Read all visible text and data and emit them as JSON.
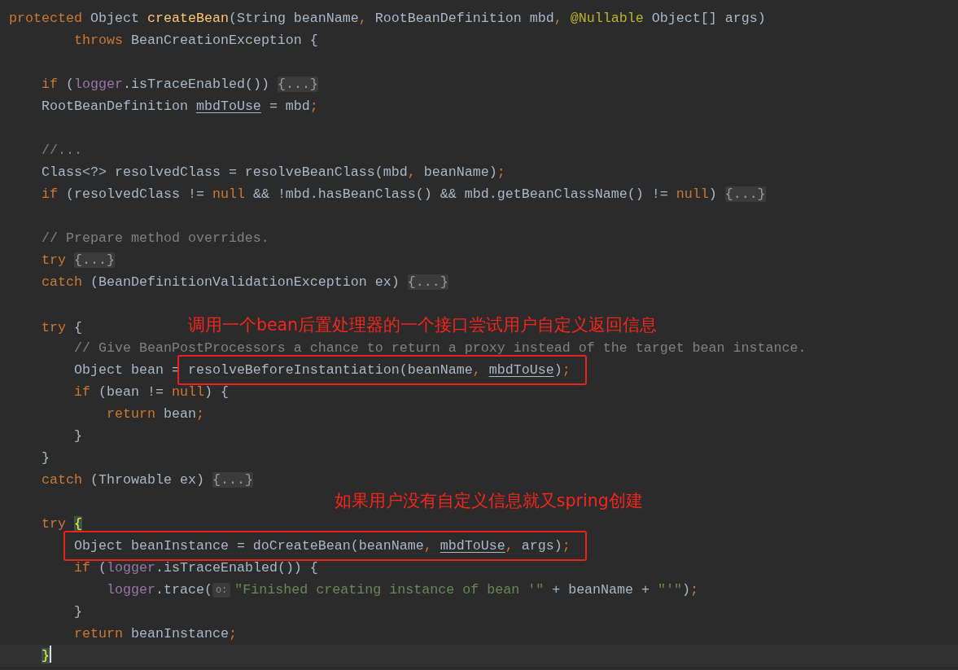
{
  "editor": {
    "lines": [
      {
        "current": false,
        "tokens": [
          {
            "kind": "kw",
            "text": "protected"
          },
          {
            "kind": "plain",
            "text": " Object "
          },
          {
            "kind": "method",
            "text": "createBean"
          },
          {
            "kind": "plain",
            "text": "(String beanName"
          },
          {
            "kind": "punct",
            "text": ","
          },
          {
            "kind": "plain",
            "text": " RootBeanDefinition mbd"
          },
          {
            "kind": "punct",
            "text": ","
          },
          {
            "kind": "annotation",
            "text": " @Nullable"
          },
          {
            "kind": "plain",
            "text": " Object[] args)"
          }
        ]
      },
      {
        "current": false,
        "tokens": [
          {
            "kind": "kw",
            "text": "        throws"
          },
          {
            "kind": "plain",
            "text": " BeanCreationException {"
          }
        ]
      },
      {
        "current": false
      },
      {
        "current": false,
        "tokens": [
          {
            "kind": "kw",
            "text": "    if"
          },
          {
            "kind": "plain",
            "text": " ("
          },
          {
            "kind": "field",
            "text": "logger"
          },
          {
            "kind": "plain",
            "text": ".isTraceEnabled()) "
          },
          {
            "kind": "fold",
            "text": "{...}"
          }
        ]
      },
      {
        "current": false,
        "tokens": [
          {
            "kind": "plain",
            "text": "    RootBeanDefinition "
          },
          {
            "kind": "var",
            "text": "mbdToUse"
          },
          {
            "kind": "plain",
            "text": " = mbd"
          },
          {
            "kind": "punct",
            "text": ";"
          }
        ]
      },
      {
        "current": false
      },
      {
        "current": false,
        "tokens": [
          {
            "kind": "comment",
            "text": "    //..."
          }
        ]
      },
      {
        "current": false,
        "tokens": [
          {
            "kind": "plain",
            "text": "    Class<?> resolvedClass = resolveBeanClass(mbd"
          },
          {
            "kind": "punct",
            "text": ","
          },
          {
            "kind": "plain",
            "text": " beanName)"
          },
          {
            "kind": "punct",
            "text": ";"
          }
        ]
      },
      {
        "current": false,
        "tokens": [
          {
            "kind": "kw",
            "text": "    if"
          },
          {
            "kind": "plain",
            "text": " (resolvedClass != "
          },
          {
            "kind": "kw",
            "text": "null"
          },
          {
            "kind": "plain",
            "text": " && !mbd.hasBeanClass() && mbd.getBeanClassName() != "
          },
          {
            "kind": "kw",
            "text": "null"
          },
          {
            "kind": "plain",
            "text": ") "
          },
          {
            "kind": "fold",
            "text": "{...}"
          }
        ]
      },
      {
        "current": false
      },
      {
        "current": false,
        "tokens": [
          {
            "kind": "comment",
            "text": "    // Prepare method overrides."
          }
        ]
      },
      {
        "current": false,
        "tokens": [
          {
            "kind": "kw",
            "text": "    try"
          },
          {
            "kind": "fold",
            "text": " {...}"
          }
        ]
      },
      {
        "current": false,
        "tokens": [
          {
            "kind": "kw",
            "text": "    catch"
          },
          {
            "kind": "plain",
            "text": " (BeanDefinitionValidationException ex) "
          },
          {
            "kind": "fold",
            "text": "{...}"
          }
        ]
      },
      {
        "current": false
      },
      {
        "current": false,
        "tokens": [
          {
            "kind": "kw",
            "text": "    try"
          },
          {
            "kind": "plain",
            "text": " {"
          },
          {
            "kind": "note",
            "text": "             调用一个bean后置处理器的一个接口尝试用户自定义返回信息"
          }
        ]
      },
      {
        "current": false,
        "tokens": [
          {
            "kind": "comment",
            "text": "        // Give BeanPostProcessors a chance to return a proxy instead of the target bean instance."
          }
        ]
      },
      {
        "current": false,
        "tokens": [
          {
            "kind": "plain",
            "text": "        Object bean = "
          },
          {
            "kind": "frame",
            "tokens": [
              {
                "kind": "plain",
                "text": "resolveBeforeInstantiation(beanName"
              },
              {
                "kind": "punct",
                "text": ","
              },
              {
                "kind": "var",
                "text": " mbdToUse"
              },
              {
                "kind": "plain",
                "text": ")"
              },
              {
                "kind": "punct",
                "text": ";"
              }
            ]
          }
        ]
      },
      {
        "current": false,
        "tokens": [
          {
            "kind": "kw",
            "text": "        if"
          },
          {
            "kind": "plain",
            "text": " (bean != "
          },
          {
            "kind": "kw",
            "text": "null"
          },
          {
            "kind": "plain",
            "text": ") {"
          }
        ]
      },
      {
        "current": false,
        "tokens": [
          {
            "kind": "kw",
            "text": "            return"
          },
          {
            "kind": "plain",
            "text": " bean"
          },
          {
            "kind": "punct",
            "text": ";"
          }
        ]
      },
      {
        "current": false,
        "tokens": [
          {
            "kind": "plain",
            "text": "        }"
          }
        ]
      },
      {
        "current": false,
        "tokens": [
          {
            "kind": "plain",
            "text": "    }"
          }
        ]
      },
      {
        "current": false,
        "tokens": [
          {
            "kind": "kw",
            "text": "    catch"
          },
          {
            "kind": "plain",
            "text": " (Throwable ex) "
          },
          {
            "kind": "fold",
            "text": "{...}"
          }
        ]
      },
      {
        "current": false,
        "tokens": [
          {
            "kind": "note",
            "text": "                                        如果用户没有自定义信息就又spring创建"
          }
        ]
      },
      {
        "current": false,
        "tokens": [
          {
            "kind": "kw",
            "text": "    try"
          },
          {
            "kind": "brace",
            "text": " {"
          }
        ]
      },
      {
        "current": false,
        "tokens": [
          {
            "kind": "frame",
            "tokens": [
              {
                "kind": "plain",
                "text": "        Object beanInstance = doCreateBean(beanName"
              },
              {
                "kind": "punct",
                "text": ","
              },
              {
                "kind": "var",
                "text": " mbdToUse"
              },
              {
                "kind": "punct",
                "text": ","
              },
              {
                "kind": "plain",
                "text": " args)"
              },
              {
                "kind": "punct",
                "text": ";"
              }
            ]
          }
        ]
      },
      {
        "current": false,
        "tokens": [
          {
            "kind": "kw",
            "text": "        if"
          },
          {
            "kind": "plain",
            "text": " ("
          },
          {
            "kind": "field",
            "text": "logger"
          },
          {
            "kind": "plain",
            "text": ".isTraceEnabled()) {"
          }
        ]
      },
      {
        "current": false,
        "tokens": [
          {
            "kind": "field",
            "text": "            logger"
          },
          {
            "kind": "plain",
            "text": ".trace("
          },
          {
            "kind": "hint",
            "text": "o:"
          },
          {
            "kind": "string",
            "text": "\"Finished creating instance of bean '\""
          },
          {
            "kind": "plain",
            "text": " + beanName + "
          },
          {
            "kind": "string",
            "text": "\"'\""
          },
          {
            "kind": "plain",
            "text": ")"
          },
          {
            "kind": "punct",
            "text": ";"
          }
        ]
      },
      {
        "current": false,
        "tokens": [
          {
            "kind": "plain",
            "text": "        }"
          }
        ]
      },
      {
        "current": false,
        "tokens": [
          {
            "kind": "kw",
            "text": "        return"
          },
          {
            "kind": "plain",
            "text": " beanInstance"
          },
          {
            "kind": "punct",
            "text": ";"
          }
        ]
      },
      {
        "current": true,
        "tokens": [
          {
            "kind": "brace",
            "text": "    }"
          }
        ]
      }
    ]
  }
}
